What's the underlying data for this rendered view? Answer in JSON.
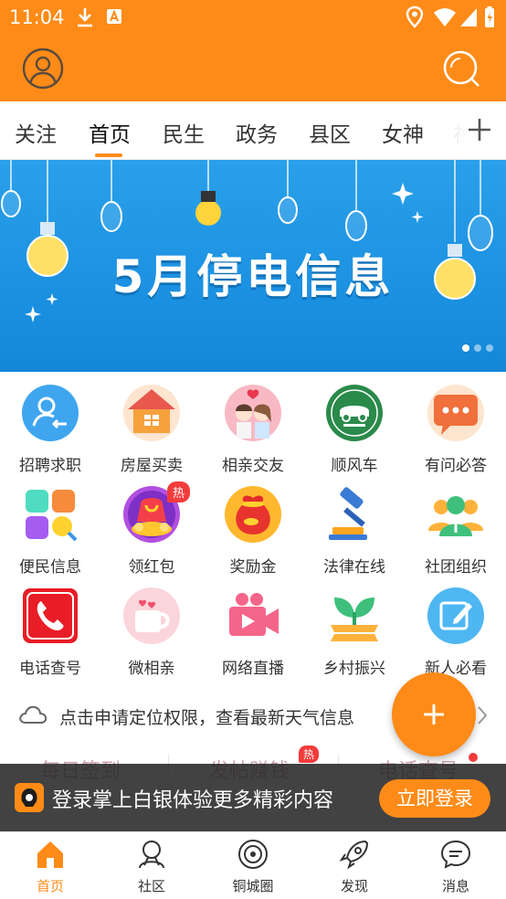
{
  "status_bar": {
    "time": "11:04"
  },
  "tabs": [
    {
      "label": "关注"
    },
    {
      "label": "首页"
    },
    {
      "label": "民生"
    },
    {
      "label": "政务"
    },
    {
      "label": "县区"
    },
    {
      "label": "女神"
    },
    {
      "label": "视"
    }
  ],
  "active_tab": "首页",
  "banner": {
    "title": "5月停电信息",
    "page_count": 3,
    "current_page": 1
  },
  "grid": [
    {
      "label": "招聘求职",
      "icon": "recruit-icon"
    },
    {
      "label": "房屋买卖",
      "icon": "house-icon"
    },
    {
      "label": "相亲交友",
      "icon": "dating-icon"
    },
    {
      "label": "顺风车",
      "icon": "carpool-icon"
    },
    {
      "label": "有问必答",
      "icon": "qa-icon"
    },
    {
      "label": "便民信息",
      "icon": "info-grid-icon"
    },
    {
      "label": "领红包",
      "icon": "red-envelope-icon",
      "badge": "热"
    },
    {
      "label": "奖励金",
      "icon": "reward-bag-icon"
    },
    {
      "label": "法律在线",
      "icon": "gavel-icon"
    },
    {
      "label": "社团组织",
      "icon": "group-icon"
    },
    {
      "label": "电话查号",
      "icon": "phone-icon"
    },
    {
      "label": "微相亲",
      "icon": "cup-heart-icon"
    },
    {
      "label": "网络直播",
      "icon": "video-camera-icon"
    },
    {
      "label": "乡村振兴",
      "icon": "sprout-icon"
    },
    {
      "label": "新人必看",
      "icon": "edit-note-icon"
    }
  ],
  "weather": {
    "text": "点击申请定位权限，查看最新天气信息"
  },
  "shortcuts": [
    {
      "label": "每日签到"
    },
    {
      "label": "发帖赚钱",
      "badge": "热"
    },
    {
      "label": "电话查号"
    }
  ],
  "login_prompt": {
    "text": "登录掌上白银体验更多精彩内容",
    "button": "立即登录"
  },
  "bottom_nav": [
    {
      "label": "首页",
      "icon": "home-icon"
    },
    {
      "label": "社区",
      "icon": "community-icon"
    },
    {
      "label": "铜城圈",
      "icon": "circle-icon"
    },
    {
      "label": "发现",
      "icon": "rocket-icon"
    },
    {
      "label": "消息",
      "icon": "message-icon"
    }
  ],
  "colors": {
    "brand": "#fe8b17",
    "banner_blue": "#1a8fe0",
    "hot_red": "#f33b3b"
  }
}
